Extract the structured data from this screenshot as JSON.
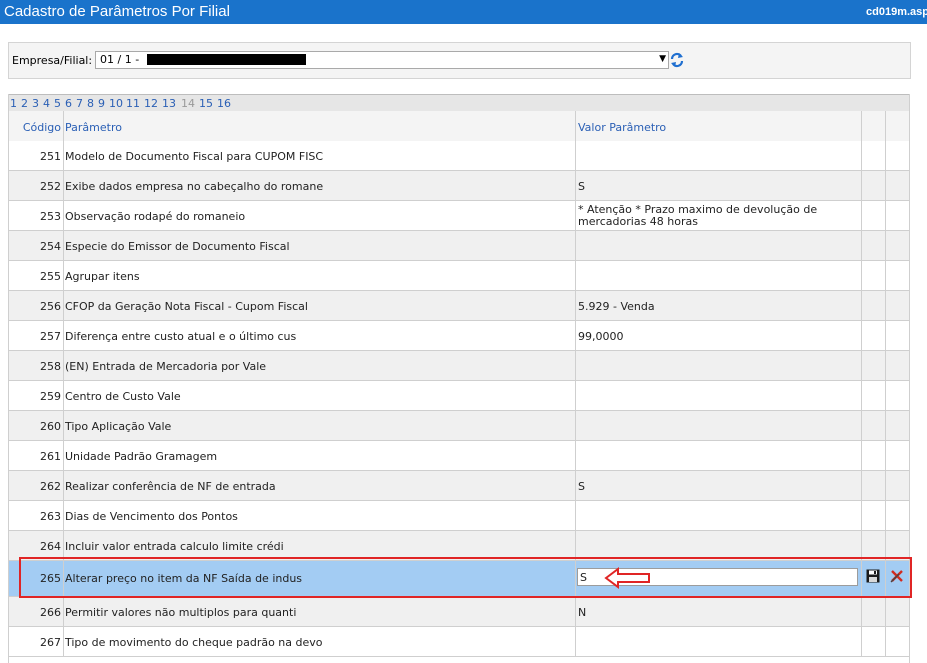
{
  "window": {
    "title": "Cadastro de Parâmetros Por Filial",
    "code": "cd019m.asp"
  },
  "filter": {
    "label": "Empresa/Filial:",
    "selected": "01 / 1 -"
  },
  "pager": {
    "pages": [
      "1",
      "2",
      "3",
      "4",
      "5",
      "6",
      "7",
      "8",
      "9",
      "10",
      "11",
      "12",
      "13",
      "14",
      "15",
      "16"
    ],
    "current": "14"
  },
  "table": {
    "headers": {
      "code": "Código",
      "param": "Parâmetro",
      "value": "Valor Parâmetro"
    },
    "rows": [
      {
        "code": "251",
        "param": "Modelo de Documento Fiscal para CUPOM FISC",
        "value": ""
      },
      {
        "code": "252",
        "param": "Exibe dados empresa no cabeçalho do romane",
        "value": "S"
      },
      {
        "code": "253",
        "param": "Observação rodapé do romaneio",
        "value": "* Atenção * Prazo maximo de devolução de mercadorias 48 horas"
      },
      {
        "code": "254",
        "param": "Especie do Emissor de Documento Fiscal",
        "value": ""
      },
      {
        "code": "255",
        "param": "Agrupar itens",
        "value": ""
      },
      {
        "code": "256",
        "param": "CFOP da Geração Nota Fiscal - Cupom Fiscal",
        "value": "5.929 - Venda"
      },
      {
        "code": "257",
        "param": "Diferença entre custo atual e o último cus",
        "value": "99,0000"
      },
      {
        "code": "258",
        "param": "(EN) Entrada de Mercadoria por Vale",
        "value": ""
      },
      {
        "code": "259",
        "param": "Centro de Custo Vale",
        "value": ""
      },
      {
        "code": "260",
        "param": "Tipo Aplicação Vale",
        "value": ""
      },
      {
        "code": "261",
        "param": "Unidade Padrão Gramagem",
        "value": ""
      },
      {
        "code": "262",
        "param": "Realizar conferência de NF de entrada",
        "value": "S"
      },
      {
        "code": "263",
        "param": "Dias de Vencimento dos Pontos",
        "value": ""
      },
      {
        "code": "264",
        "param": "Incluir valor entrada calculo limite crédi",
        "value": ""
      },
      {
        "code": "265",
        "param": "Alterar preço no item da NF Saída de indus",
        "value": "S"
      },
      {
        "code": "266",
        "param": "Permitir valores não multiplos para quanti",
        "value": "N"
      },
      {
        "code": "267",
        "param": "Tipo de movimento do cheque padrão na devo",
        "value": ""
      }
    ]
  },
  "icons": {
    "refresh": "refresh-icon",
    "save": "save-icon",
    "cancel": "cancel-icon"
  },
  "colors": {
    "titlebar": "#1a73cb",
    "selected_row": "#a3ccf3",
    "annotation": "#e02525",
    "link": "#2a5fb5"
  }
}
